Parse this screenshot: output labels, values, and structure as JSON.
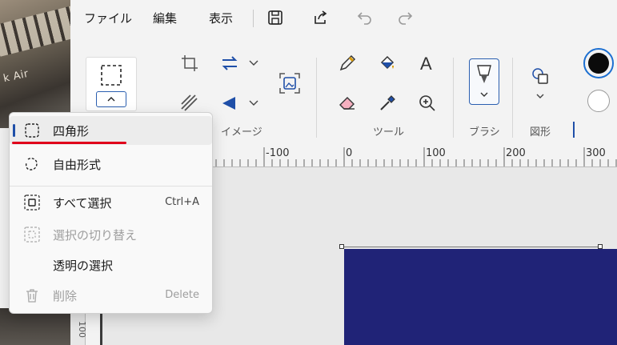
{
  "thumbnail": {
    "overlay_text": "k Air"
  },
  "menubar": {
    "file": "ファイル",
    "edit": "編集",
    "view": "表示"
  },
  "ribbon": {
    "groups": {
      "image": "イメージ",
      "tools": "ツール",
      "brush": "ブラシ",
      "shapes": "図形"
    },
    "colors": {
      "primary": "#0b0b0b",
      "secondary": "#ffffff"
    }
  },
  "ruler": {
    "labels": [
      "-100",
      "0",
      "100",
      "200",
      "300"
    ]
  },
  "canvas": {
    "image_color": "#202377",
    "side_label": "100"
  },
  "selection_menu": {
    "items": [
      {
        "label": "四角形",
        "shortcut": "",
        "icon": "rectangle-select-icon",
        "enabled": true,
        "selected": true
      },
      {
        "label": "自由形式",
        "shortcut": "",
        "icon": "freeform-select-icon",
        "enabled": true,
        "selected": false
      },
      {
        "label": "すべて選択",
        "shortcut": "Ctrl+A",
        "icon": "select-all-icon",
        "enabled": true,
        "selected": false
      },
      {
        "label": "選択の切り替え",
        "shortcut": "",
        "icon": "invert-selection-icon",
        "enabled": false,
        "selected": false
      },
      {
        "label": "透明の選択",
        "shortcut": "",
        "icon": "",
        "enabled": true,
        "selected": false
      },
      {
        "label": "削除",
        "shortcut": "Delete",
        "icon": "trash-icon",
        "enabled": false,
        "selected": false
      }
    ],
    "highlight_color": "#e0001b"
  }
}
